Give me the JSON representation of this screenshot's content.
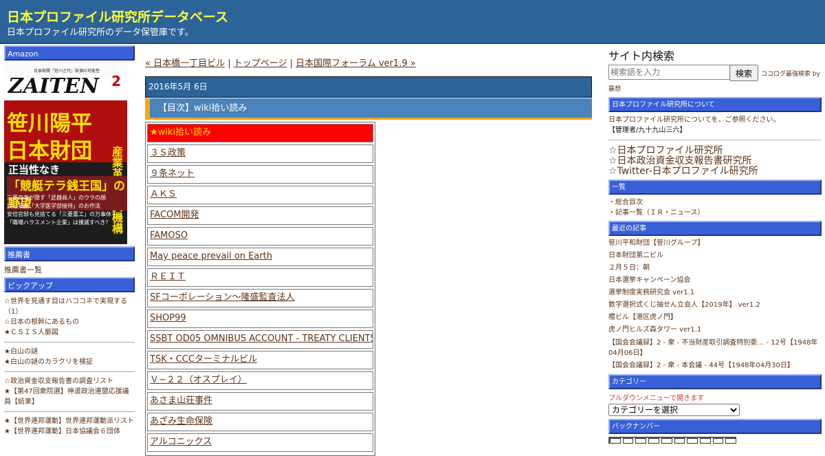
{
  "header": {
    "title": "日本プロファイル研究所データベース",
    "description": "日本プロファイル研究所のデータ保管庫です。"
  },
  "left": {
    "amazon_heading": "Amazon",
    "book": {
      "top_text": "日本財閥「笹川之代」財源の可能性",
      "masthead": "ZAITEN",
      "issue": "2",
      "headline_1": "笹川陽平",
      "headline_2": "日本財団",
      "vertical": "産業革新投資機構",
      "sub_1": "正当性なき",
      "sub_2": "「競艇テラ銭王国」の野望",
      "lines": [
        "三菱商事が隠す「武器商人」のウラの顔",
        "武田薬品「大学医学部接待」のお作法",
        "安倍官邸も見捨てる「三菱重工」の万事休す",
        "「職場ハラスメント企業」は撲滅すべき？"
      ]
    },
    "recommend_heading": "推薦書",
    "recommend_link": "推薦書一覧",
    "pickup_heading": "ピックアップ",
    "pickup_groups": [
      [
        "☆世界を見通す目はハココネで実現する（1）",
        "☆日本の根幹にあるもの",
        "★ＣＳＩＳ人脈図"
      ],
      [
        "★白山の謎",
        "★白山の謎のカラクリを検証"
      ],
      [
        "☆政治資金収支報告書の調査リスト",
        "★【第47回衆院選】神道政治連盟応援議員【結果】"
      ],
      [
        "★【世界連邦運動】世界連邦運動派リスト",
        "★【世界連邦運動】日本協議会６団体"
      ]
    ]
  },
  "main": {
    "nav": {
      "prev": "« 日本橋一丁目ビル",
      "sep": " | ",
      "top": "トップページ",
      "next": "日本国際フォーラム ver1.9 »"
    },
    "date": "2016年5月 6日",
    "post_title": "【目次】wiki拾い読み",
    "rows": [
      "★wiki拾い読み",
      "３Ｓ政策",
      "９条ネット",
      "ＡＫＳ",
      "FACOM開発",
      "FAMOSO",
      "May peace prevail on Earth",
      "ＲＥＩＴ",
      "SFコーポレーション〜隆盛監査法人",
      "SHOP99",
      "SSBT OD05 OMNIBUS ACCOUNT - TREATY CLIENTS",
      "TSK・CCCターミナルビル",
      "Ｖ−２２（オスプレイ）",
      "あさま山荘事件",
      "あざみ生命保険",
      "アルコニックス"
    ]
  },
  "right": {
    "search_title": "サイト内検索",
    "search_placeholder": "検索語を入力",
    "search_button": "検索",
    "search_credit": "ココログ最強検索 by",
    "search_credit_2": "暴想",
    "about_heading": "日本プロファイル研究所について",
    "about_text": "日本プロファイル研究所についてを、ご参照ください。",
    "admin_text": "【管理者/九十九山三六】",
    "big_links": [
      "☆日本プロファイル研究所",
      "☆日本政治資金収支報告書研究所",
      "☆Twitter-日本プロファイル研究所"
    ],
    "list_heading": "一覧",
    "list_items": [
      "・総合目次",
      "・記事一覧（ＩＲ・ニュース）"
    ],
    "recent_heading": "最近の記事",
    "recent_items": [
      "笹川平和財団【笹川グループ】",
      "日本財団第二ビル",
      "２月５日：朝",
      "日本選挙キャンペーン協会",
      "選挙制度実務研究会 ver1.1",
      "数字選択式くじ抽せん立会人【2019年】 ver1.2",
      "櫻ビル【港区虎ノ門】",
      "虎ノ門ヒルズ森タワー ver1.1",
      "【国会会議録】2 - 衆 - 不当財産取引調査特別委… - 12号【1948年04月06日】",
      "【国会会議録】2 - 衆 - 本会議 - 44号【1948年04月30日】"
    ],
    "category_heading": "カテゴリー",
    "dropdown_note": "プルダウンメニューで開きます",
    "category_select": "カテゴリーを選択",
    "backnumber_heading": "バックナンバー"
  }
}
